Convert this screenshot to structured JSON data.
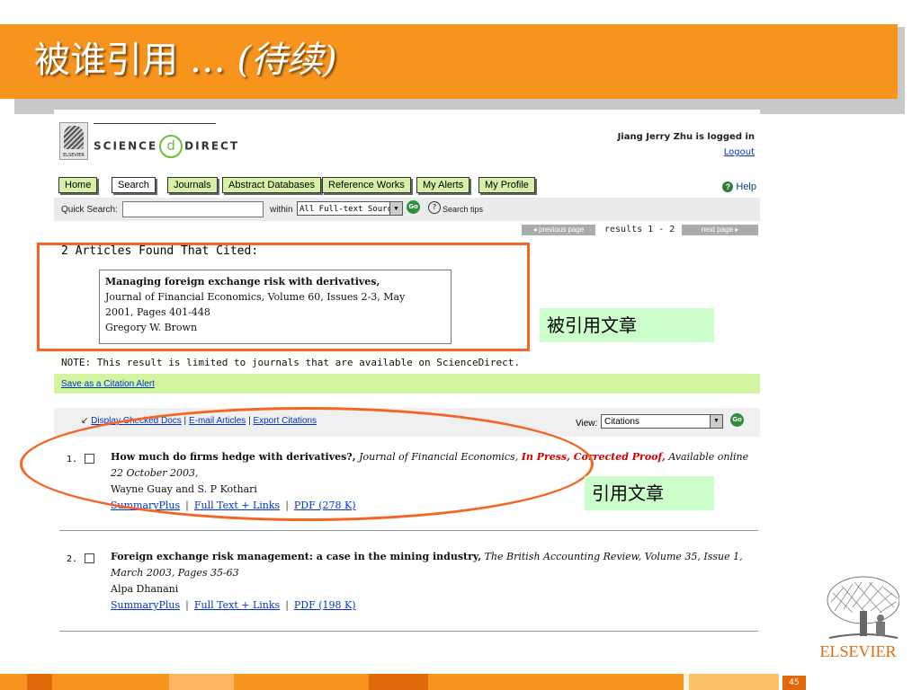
{
  "slide": {
    "title_main": "被谁引用 …",
    "title_sub": "(待续)",
    "page_number": "45",
    "brand": "ELSEVIER"
  },
  "header": {
    "logo_brand": "ELSEVIER",
    "logo_science": "SCIENCE",
    "logo_at": "d",
    "logo_direct": "DIRECT",
    "logged_in": "Jiang Jerry Zhu is logged in",
    "logout": "Logout"
  },
  "nav": {
    "items": [
      "Home",
      "Search",
      "Journals",
      "Abstract Databases",
      "Reference Works",
      "My Alerts",
      "My Profile"
    ],
    "help": "Help"
  },
  "quick_search": {
    "label": "Quick Search:",
    "value": "",
    "within_label": "within",
    "sources": "All Full-text Sources",
    "go": "Go",
    "tips": "Search tips"
  },
  "pagination": {
    "previous": "◂ previous page",
    "results": "results 1 - 2",
    "next": "next page ▸"
  },
  "found": {
    "heading": "2 Articles Found That Cited:",
    "cited_title": "Managing foreign exchange risk with derivatives,",
    "cited_journal": "Journal of Financial Economics, Volume 60, Issues 2-3, May",
    "cited_pages": "2001, Pages 401-448",
    "cited_author": "Gregory W. Brown"
  },
  "note": "NOTE: This result is limited to journals that are available on ScienceDirect.",
  "alert_link": "Save as a Citation Alert",
  "actions": {
    "display_checked": "Display Checked Docs",
    "email": "E-mail Articles",
    "export": "Export Citations",
    "view_label": "View:",
    "view_value": "Citations"
  },
  "results": [
    {
      "num": "1.",
      "title": "How much do firms hedge with derivatives?,",
      "journal": "Journal of Financial Economics,",
      "status": "In Press, Corrected Proof,",
      "online": "Available online 22 October 2003,",
      "authors": "Wayne Guay and S. P Kothari",
      "links": [
        "SummaryPlus",
        "Full Text + Links",
        "PDF (278 K)"
      ]
    },
    {
      "num": "2.",
      "title": "Foreign exchange risk management: a case in the mining industry,",
      "journal": "The British Accounting Review, Volume 35, Issue 1, March 2003, Pages 35-63",
      "authors": "Alpa Dhanani",
      "links": [
        "SummaryPlus",
        "Full Text + Links",
        "PDF (198 K)"
      ]
    }
  ],
  "annotations": {
    "cited_label": "被引用文章",
    "citing_label": "引用文章",
    "color": "#f26522"
  },
  "colors": {
    "title_bar": "#f7941d",
    "highlight_green": "#d4f5a0",
    "label_green": "#ccffcc",
    "link_blue": "#0033cc",
    "status_red": "#d00000"
  }
}
